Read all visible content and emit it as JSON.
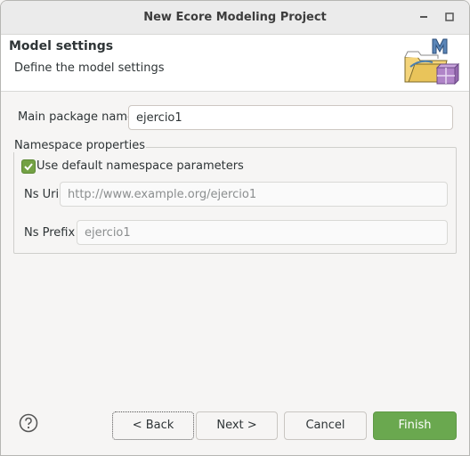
{
  "window": {
    "title": "New Ecore Modeling Project"
  },
  "header": {
    "title": "Model settings",
    "description": "Define the model settings",
    "icon": "ecore-model-folder-icon"
  },
  "form": {
    "main_package_label": "Main package name",
    "main_package_value": "ejercio1",
    "namespace_group_title": "Namespace properties",
    "use_default_label": "Use default namespace parameters",
    "use_default_checked": true,
    "ns_uri_label": "Ns Uri",
    "ns_uri_value": "http://www.example.org/ejercio1",
    "ns_prefix_label": "Ns Prefix",
    "ns_prefix_value": "ejercio1"
  },
  "buttons": {
    "help_icon": "help-icon",
    "back": "< Back",
    "next": "Next >",
    "cancel": "Cancel",
    "finish": "Finish"
  },
  "colors": {
    "accent": "#6aa84f",
    "checkbox": "#73a144"
  }
}
